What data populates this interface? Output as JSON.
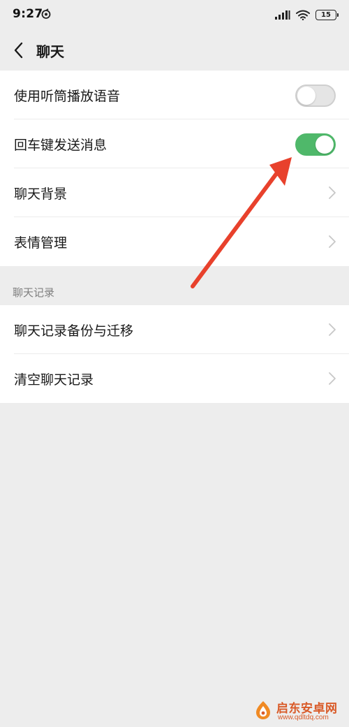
{
  "status_bar": {
    "time": "9:27",
    "battery_level": "15",
    "app_icon": "notification-app-icon",
    "signal_icon": "signal-bars-icon",
    "wifi_icon": "wifi-icon"
  },
  "nav": {
    "back_icon": "chevron-left-icon",
    "title": "聊天"
  },
  "settings": {
    "use_earpiece": {
      "label": "使用听筒播放语音",
      "enabled": false
    },
    "enter_to_send": {
      "label": "回车键发送消息",
      "enabled": true
    },
    "chat_background": {
      "label": "聊天背景"
    },
    "sticker_management": {
      "label": "表情管理"
    }
  },
  "chat_history": {
    "header": "聊天记录",
    "items": [
      {
        "label": "聊天记录备份与迁移"
      },
      {
        "label": "清空聊天记录"
      }
    ]
  },
  "watermark": {
    "name": "启东安卓网",
    "url": "www.qdltdq.com"
  },
  "colors": {
    "background": "#ededed",
    "card": "#ffffff",
    "toggle_on": "#4fb86a",
    "toggle_off": "#e5e5e5",
    "annotation_arrow": "#e8412c",
    "watermark": "#d95a28"
  }
}
